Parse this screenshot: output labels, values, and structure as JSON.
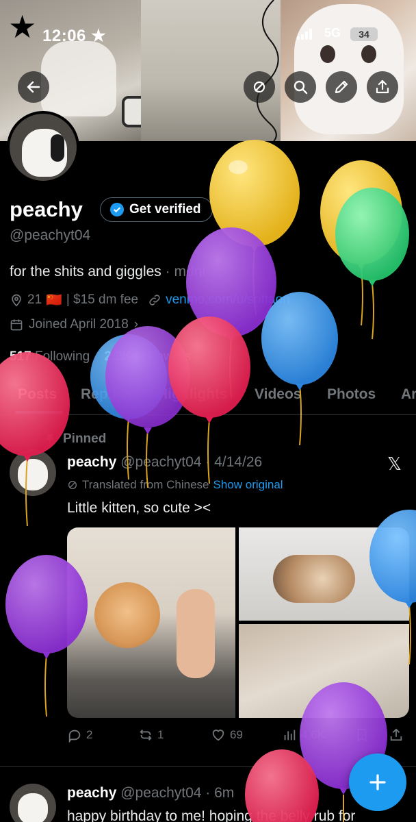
{
  "status_bar": {
    "time": "12:06",
    "time_star": "★",
    "network": "5G",
    "battery": "34"
  },
  "profile": {
    "display_name": "peachy",
    "get_verified_label": "Get verified",
    "handle": "@peachyt04",
    "bio_main": "for the shits and giggles",
    "bio_tag": "· mdni",
    "age": "21",
    "flag": "🇨🇳",
    "fee": "| $15 dm fee",
    "link": "venmo.com/u/softaon",
    "joined": "Joined April 2018",
    "following_count": "517",
    "following_label": "Following",
    "followers_count": "2.2K",
    "followers_label": "Followers"
  },
  "tabs": [
    "Posts",
    "Replies",
    "Highlights",
    "Videos",
    "Photos",
    "Ar"
  ],
  "active_tab": "Posts",
  "pinned_post": {
    "pinned_label": "Pinned",
    "author": "peachy",
    "handle_date": "@peachyt04 · 4/14/26",
    "translated_label": "Translated from Chinese",
    "show_original": "Show original",
    "text": "Little kitten, so cute ><",
    "replies": "2",
    "reposts": "1",
    "likes": "69",
    "views": "4.6K"
  },
  "second_post": {
    "author": "peachy",
    "handle_date": "@peachyt04 · 6m",
    "text": "happy birthday to me! hoping the belly rub for"
  },
  "icons": {
    "back": "back-arrow-icon",
    "mute": "mute-icon",
    "search": "search-icon",
    "edit": "pencil-icon",
    "share": "share-icon",
    "compose": "plus-icon",
    "platform": "x-logo-icon"
  },
  "colors": {
    "accent": "#1d9bf0",
    "background": "#000000",
    "muted_text": "#71767b",
    "divider": "#2f3336"
  }
}
